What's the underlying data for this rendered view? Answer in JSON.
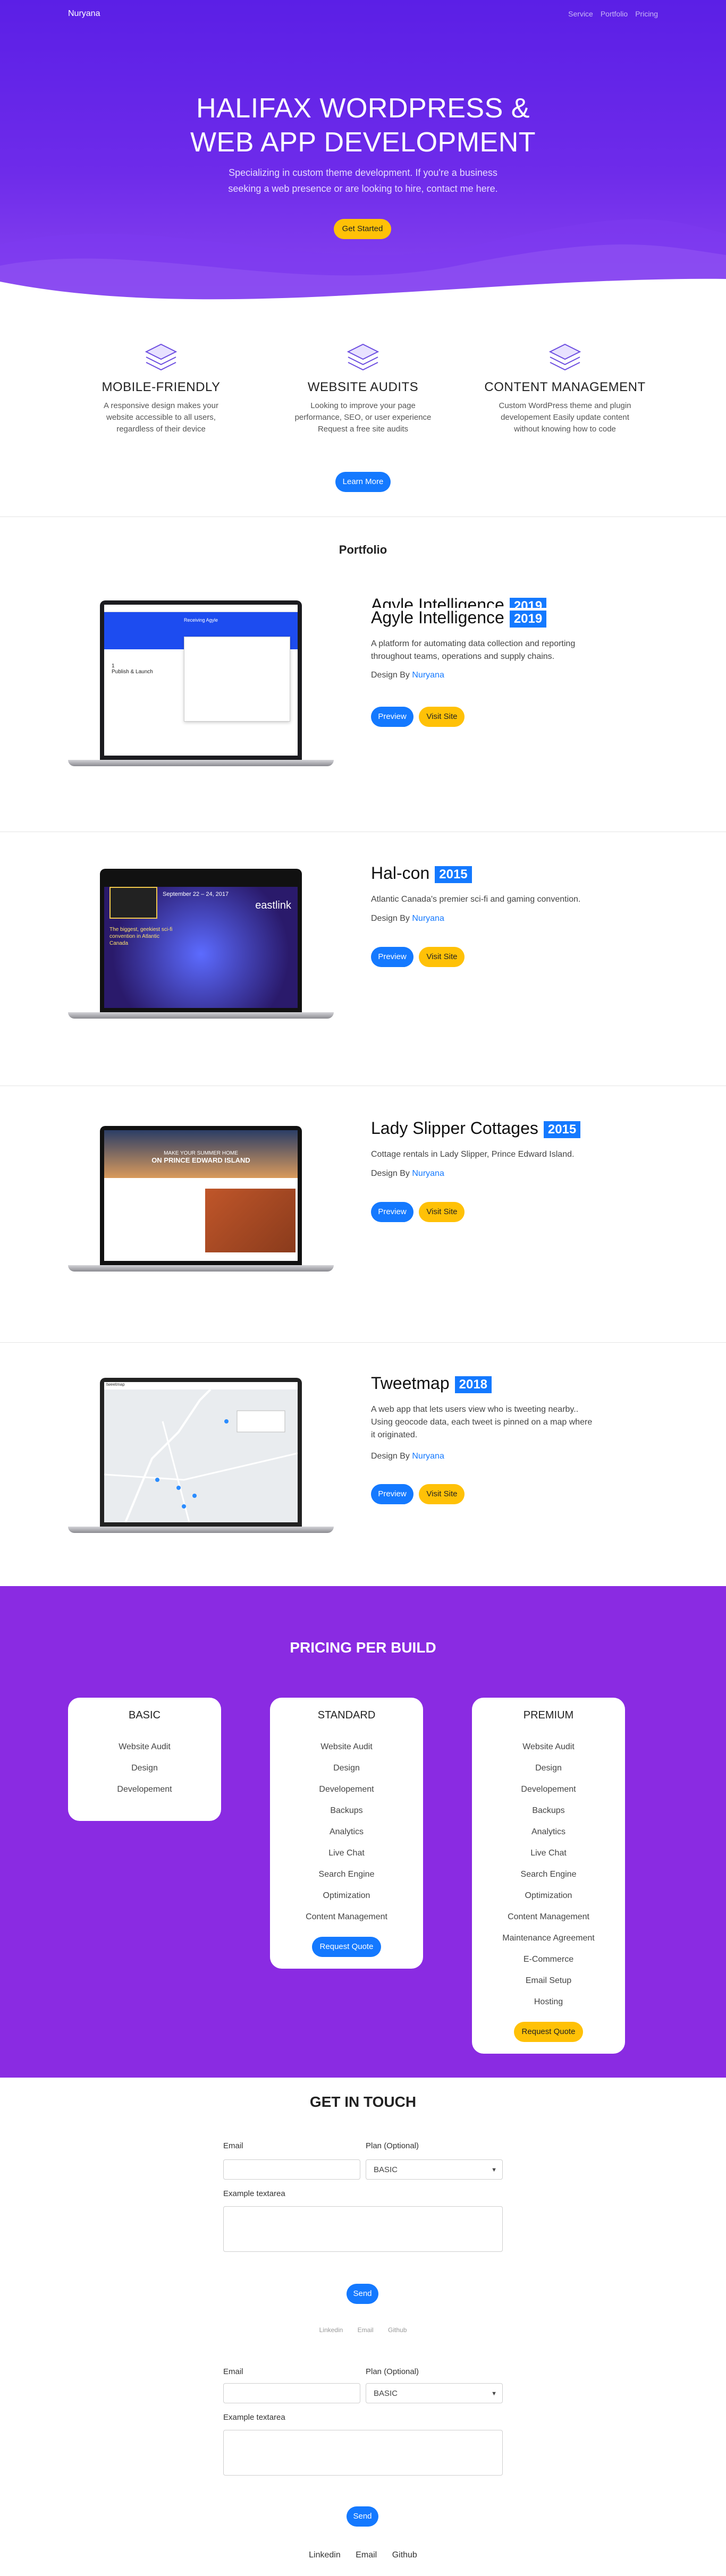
{
  "nav": {
    "brand": "Nuryana",
    "links": [
      "Service",
      "Portfolio",
      "Pricing"
    ]
  },
  "hero": {
    "title_line1": "HALIFAX WORDPRESS &",
    "title_line2": "WEB APP DEVELOPMENT",
    "subtitle_line1": "Specializing in custom theme development. If you're a business",
    "subtitle_line2": "seeking a web presence or are looking to hire, contact me here.",
    "cta": "Get Started"
  },
  "features": [
    {
      "icon": "layers-icon",
      "title": "MOBILE-FRIENDLY",
      "text": "A responsive design makes your website accessible to all users, regardless of their device"
    },
    {
      "icon": "layers-icon",
      "title": "WEBSITE AUDITS",
      "text": "Looking to improve your page performance, SEO, or user experience Request a free site audits"
    },
    {
      "icon": "layers-icon",
      "title": "CONTENT MANAGEMENT",
      "text": "Custom WordPress theme and plugin developement Easily update content without knowing how to code"
    }
  ],
  "learn_more": "Learn More",
  "portfolio": {
    "heading": "Portfolio",
    "design_by_label": "Design By",
    "designer": "Nuryana",
    "preview_label": "Preview",
    "visit_label": "Visit Site",
    "projects": [
      {
        "name": "Agyle Intelligence",
        "year": "2019",
        "description": "A platform for automating data collection and reporting throughout teams, operations and supply chains."
      },
      {
        "name": "Hal-con",
        "year": "2015",
        "description": "Atlantic Canada's premier sci-fi and gaming convention."
      },
      {
        "name": "Lady Slipper Cottages",
        "year": "2015",
        "description": "Cottage rentals in Lady Slipper, Prince Edward Island."
      },
      {
        "name": "Tweetmap",
        "year": "2018",
        "description": "A web app that lets users view who is tweeting nearby.. Using geocode data, each tweet is pinned on a map where it originated."
      }
    ],
    "screens": {
      "agyle_heading": "Receiving Agyle",
      "agyle_step": "1",
      "agyle_step_text": "Publish & Launch",
      "halcon_dates": "September 22 – 24, 2017",
      "halcon_tagline": "The biggest, geekiest sci-fi convention in Atlantic Canada",
      "halcon_partner": "eastlink",
      "lady_banner_line1": "MAKE YOUR SUMMER HOME",
      "lady_banner_line2": "ON PRINCE EDWARD ISLAND",
      "tweet_app": "tweetmap"
    }
  },
  "pricing": {
    "heading": "PRICING PER BUILD",
    "plans": [
      {
        "name": "BASIC",
        "items": [
          "Website Audit",
          "Design",
          "Developement"
        ],
        "button": ""
      },
      {
        "name": "STANDARD",
        "items": [
          "Website Audit",
          "Design",
          "Developement",
          "Backups",
          "Analytics",
          "Live Chat",
          "Search Engine",
          "Optimization",
          "Content Management"
        ],
        "button": "Request Quote"
      },
      {
        "name": "PREMIUM",
        "items": [
          "Website Audit",
          "Design",
          "Developement",
          "Backups",
          "Analytics",
          "Live Chat",
          "Search Engine",
          "Optimization",
          "Content Management",
          "Maintenance Agreement",
          "E-Commerce",
          "Email Setup",
          "Hosting"
        ],
        "button": "Request Quote"
      }
    ]
  },
  "contact": {
    "heading": "GET IN TOUCH",
    "email_label": "Email",
    "plan_label": "Plan (Optional)",
    "plan_selected": "BASIC",
    "textarea_label": "Example textarea",
    "send_label": "Send",
    "footer_links": [
      "Linkedin",
      "Email",
      "Github"
    ]
  },
  "colors": {
    "primary": "#1479ff",
    "accent": "#ffc107",
    "hero": "#5b1fe6",
    "pricing": "#8a2be2"
  }
}
